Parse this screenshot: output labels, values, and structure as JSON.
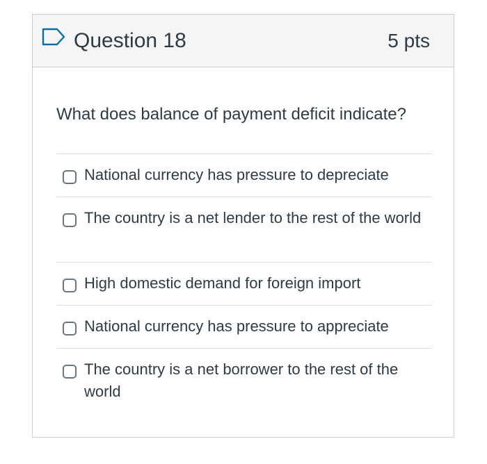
{
  "question": {
    "title": "Question 18",
    "points": "5 pts",
    "text": "What does balance of payment deficit indicate?",
    "flag_icon": "flag-outline-icon",
    "accent_color": "#0770a3"
  },
  "answers": [
    {
      "label": "National currency has pressure to depreciate",
      "selected": false
    },
    {
      "label": "The country is a net lender to the rest of the world",
      "selected": false
    },
    {
      "label": "High domestic demand for foreign import",
      "selected": false
    },
    {
      "label": "National currency has pressure to appreciate",
      "selected": false
    },
    {
      "label": "The country is a net borrower to the rest of the world",
      "selected": false
    }
  ]
}
